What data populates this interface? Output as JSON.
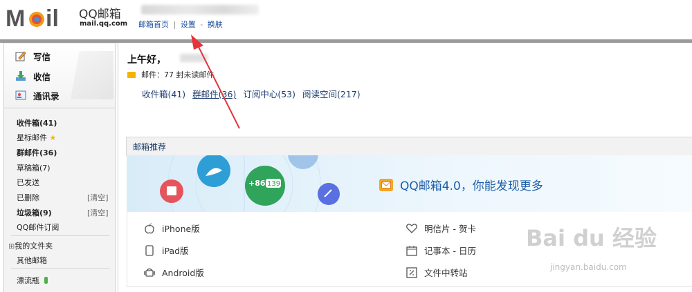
{
  "header": {
    "brand": "QQ邮箱",
    "domain": "mail.qq.com",
    "links": [
      "邮箱首页",
      "设置",
      "换肤"
    ],
    "separators": [
      "|",
      "-"
    ]
  },
  "left": {
    "quick": [
      "写信",
      "收信",
      "通讯录"
    ],
    "folders": [
      {
        "label": "收件箱(41)"
      },
      {
        "label": "星标邮件"
      },
      {
        "label": "群邮件(36)"
      },
      {
        "label": "草稿箱(7)"
      },
      {
        "label": "已发送"
      },
      {
        "label": "已删除",
        "action": "[清空]"
      },
      {
        "label": "垃圾箱(9)",
        "action": "[清空]"
      },
      {
        "label": "QQ邮件订阅"
      },
      {
        "label": "我的文件夹"
      },
      {
        "label": "其他邮箱"
      },
      {
        "label": "漂流瓶"
      }
    ],
    "collapse_sign": "⊞"
  },
  "main": {
    "greeting": "上午好，",
    "mail_prefix": "邮件：77 封",
    "mail_suffix": "未读邮件",
    "boxes": [
      "收件箱(41)",
      "群邮件(36)",
      "订阅中心(53)",
      "阅读空间(217)"
    ],
    "recommend": {
      "title": "邮箱推荐",
      "promo": "QQ邮箱4.0，你能发现更多",
      "badge_text": "+86",
      "badge_num": "139"
    },
    "features": {
      "left": [
        "iPhone版",
        "iPad版",
        "Android版"
      ],
      "right": [
        "明信片 - 贺卡",
        "记事本 - 日历",
        "文件中转站"
      ]
    }
  },
  "watermark": {
    "main": "Bai du 经验",
    "sub": "jingyan.baidu.com"
  },
  "colors": {
    "accent": "#1a4f9c",
    "star": "#f5b400",
    "promo": "#1d5da8"
  }
}
